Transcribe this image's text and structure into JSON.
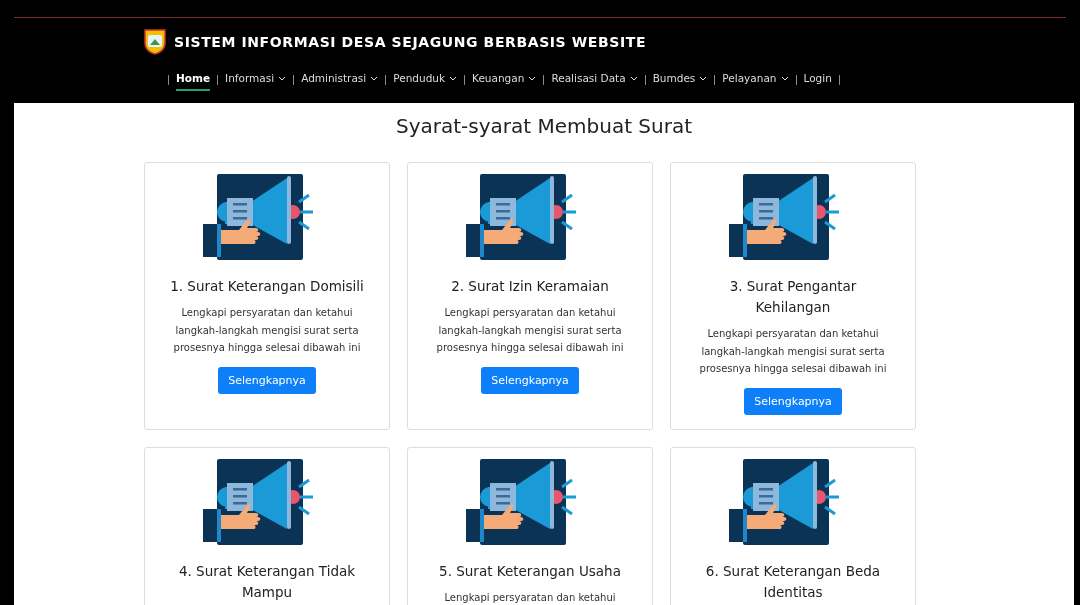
{
  "header": {
    "title": "SISTEM INFORMASI DESA SEJAGUNG BERBASIS WEBSITE"
  },
  "nav": [
    {
      "label": "Home",
      "selected": true,
      "dropdown": false
    },
    {
      "label": "Informasi",
      "selected": false,
      "dropdown": true
    },
    {
      "label": "Administrasi",
      "selected": false,
      "dropdown": true
    },
    {
      "label": "Penduduk",
      "selected": false,
      "dropdown": true
    },
    {
      "label": "Keuangan",
      "selected": false,
      "dropdown": true
    },
    {
      "label": "Realisasi Data",
      "selected": false,
      "dropdown": true
    },
    {
      "label": "Bumdes",
      "selected": false,
      "dropdown": true
    },
    {
      "label": "Pelayanan",
      "selected": false,
      "dropdown": true
    },
    {
      "label": "Login",
      "selected": false,
      "dropdown": false
    }
  ],
  "page_title": "Syarat-syarat Membuat Surat",
  "cards": [
    {
      "title": "1. Surat Keterangan Domisili",
      "description": "Lengkapi persyaratan dan ketahui langkah-langkah mengisi surat serta prosesnya hingga selesai dibawah ini",
      "button": "Selengkapnya"
    },
    {
      "title": "2. Surat Izin Keramaian",
      "description": "Lengkapi persyaratan dan ketahui langkah-langkah mengisi surat serta prosesnya hingga selesai dibawah ini",
      "button": "Selengkapnya"
    },
    {
      "title": "3. Surat Pengantar Kehilangan",
      "description": "Lengkapi persyaratan dan ketahui langkah-langkah mengisi surat serta prosesnya hingga selesai dibawah ini",
      "button": "Selengkapnya"
    },
    {
      "title": "4. Surat Keterangan Tidak Mampu"
    },
    {
      "title": "5. Surat Keterangan Usaha",
      "description": "Lengkapi persyaratan dan ketahui"
    },
    {
      "title": "6. Surat Keterangan Beda Identitas"
    }
  ]
}
